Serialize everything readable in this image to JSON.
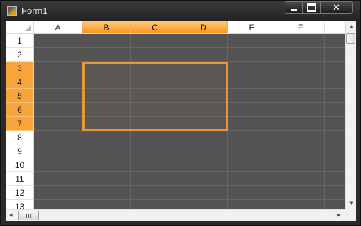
{
  "window": {
    "title": "Form1",
    "min_icon": "minimize-icon",
    "max_icon": "maximize-icon",
    "close_glyph": "✕"
  },
  "grid": {
    "columns": [
      {
        "label": "A",
        "selected": false
      },
      {
        "label": "B",
        "selected": true
      },
      {
        "label": "C",
        "selected": true
      },
      {
        "label": "D",
        "selected": true
      },
      {
        "label": "E",
        "selected": false
      },
      {
        "label": "F",
        "selected": false
      },
      {
        "label": "",
        "selected": false
      }
    ],
    "rows": [
      {
        "label": "1",
        "selected": false
      },
      {
        "label": "2",
        "selected": false
      },
      {
        "label": "3",
        "selected": true
      },
      {
        "label": "4",
        "selected": true
      },
      {
        "label": "5",
        "selected": true
      },
      {
        "label": "6",
        "selected": true
      },
      {
        "label": "7",
        "selected": true
      },
      {
        "label": "8",
        "selected": false
      },
      {
        "label": "9",
        "selected": false
      },
      {
        "label": "10",
        "selected": false
      },
      {
        "label": "11",
        "selected": false
      },
      {
        "label": "12",
        "selected": false
      },
      {
        "label": "13",
        "selected": false
      }
    ],
    "selection_range": "B3:D7"
  },
  "scrollbars": {
    "up_glyph": "▲",
    "down_glyph": "▼",
    "left_glyph": "◀",
    "right_glyph": "▶"
  },
  "colors": {
    "cell_bg": "#545454",
    "selection_accent": "#f8951d",
    "selection_border": "#e8963a"
  }
}
